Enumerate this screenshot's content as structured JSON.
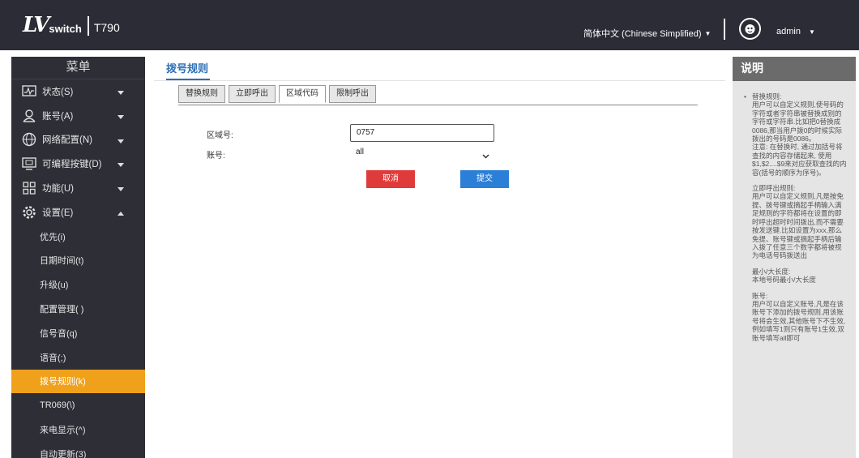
{
  "header": {
    "logo_mark": "LV",
    "logo_switch": "switch",
    "model": "T790",
    "language": "简体中文 (Chinese Simplified)",
    "language_caret": "▼",
    "user": "admin",
    "user_caret": "▼"
  },
  "sidebar": {
    "title": "菜单",
    "items": [
      {
        "label": "状态(S)",
        "icon": "status-icon",
        "caret": "▼"
      },
      {
        "label": "账号(A)",
        "icon": "account-icon",
        "caret": "▼"
      },
      {
        "label": "网络配置(N)",
        "icon": "network-icon",
        "caret": "▼"
      },
      {
        "label": "可编程按键(D)",
        "icon": "dsskey-icon",
        "caret": "▼"
      },
      {
        "label": "功能(U)",
        "icon": "features-icon",
        "caret": "▼"
      },
      {
        "label": "设置(E)",
        "icon": "settings-icon",
        "caret": "▲"
      }
    ],
    "subitems": [
      "优先(i)",
      "日期时间(t)",
      "升级(u)",
      "配置管理( )",
      "信号音(q)",
      "语音(;)",
      "拨号规则(k)",
      "TR069(\\)",
      "来电显示(^)",
      "自动更新(3)"
    ]
  },
  "main": {
    "title": "拨号规则",
    "tabs": [
      "替换规则",
      "立即呼出",
      "区域代码",
      "限制呼出"
    ],
    "active_tab": 2,
    "form": {
      "area_code_label": "区域号:",
      "area_code_value": "0757",
      "account_label": "账号:",
      "account_value": "all"
    },
    "buttons": {
      "cancel": "取消",
      "submit": "提交"
    }
  },
  "help": {
    "title": "说明",
    "replace_rule": "替换规则:\n用户可以自定义规则,使号码的字符或者字符串被替换成别的字符或字符串.比如把0替换成0086,那当用户拨0的时候实际拨出的号码是0086。\n注意: 在替换时, 通过加括号将查找的内容存储起来, 使用$1,$2....$9来对应获取查找的内容(括号的顺序为序号)。",
    "dial_now": "立即呼出规则:\n用户可以自定义规则,凡是按免提、拨号键或摘起手柄输入满足规则的字符都将在设置的即时呼出超时时间拨出,而不需要按发送键.比如设置为xxx,那么免提、账号键或摘起手柄后输入拨了任意三个数字都将被视为电话号码拨送出",
    "min_max": "最小/大长度:\n本地号码最小/大长度",
    "account": "账号:\n用户可以自定义账号,凡是在该账号下添加的拨号规则,用该账号将会生效,其他账号下不生效,例如填写1则只有账号1生效,双账号填写all即可"
  },
  "colors": {
    "header_bg": "#2b2c35",
    "sidebar_bg": "#2d2e36",
    "active_item": "#f0a11c",
    "title_blue": "#2c6fb4",
    "cancel_red": "#e03b3b",
    "submit_blue": "#2c7fd6"
  }
}
